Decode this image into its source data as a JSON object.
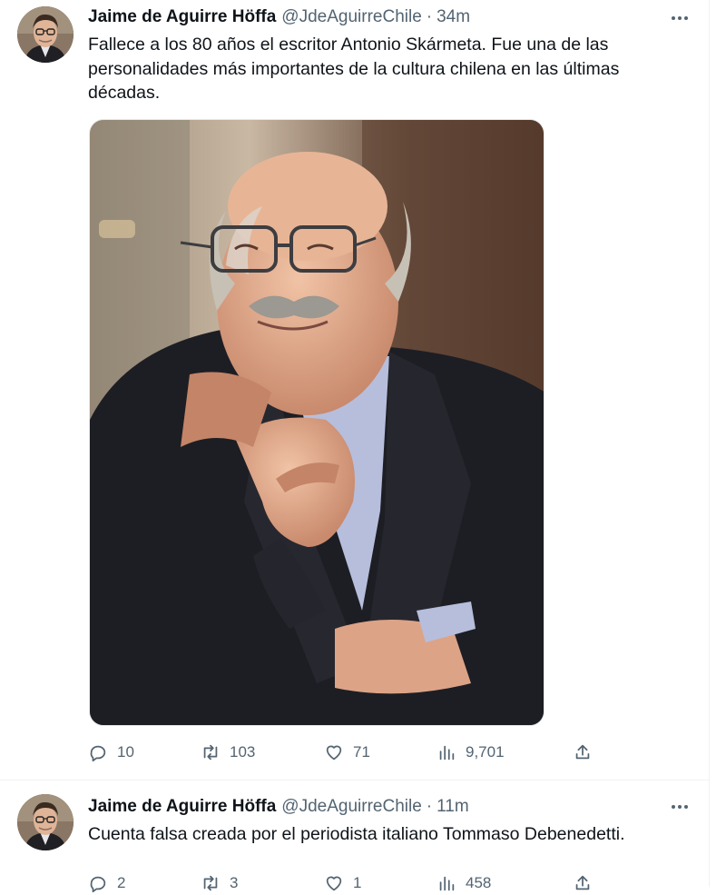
{
  "tweets": [
    {
      "author_name": "Jaime de Aguirre Höffa",
      "handle": "@JdeAguirreChile",
      "separator": "·",
      "time": "34m",
      "text": "Fallece a los 80 años el escritor Antonio Skármeta. Fue una de las personalidades más importantes de la cultura chilena en las últimas décadas.",
      "media": "photo",
      "stats": {
        "replies": "10",
        "retweets": "103",
        "likes": "71",
        "views": "9,701"
      }
    },
    {
      "author_name": "Jaime de Aguirre Höffa",
      "handle": "@JdeAguirreChile",
      "separator": "·",
      "time": "11m",
      "text": "Cuenta falsa creada por el periodista italiano Tommaso Debenedetti.",
      "stats": {
        "replies": "2",
        "retweets": "3",
        "likes": "1",
        "views": "458"
      }
    }
  ],
  "icons": {
    "more": "more-horizontal-icon",
    "reply": "reply-icon",
    "retweet": "retweet-icon",
    "like": "heart-icon",
    "views": "analytics-icon",
    "share": "share-icon"
  },
  "colors": {
    "text": "#0f1419",
    "secondary": "#536471",
    "border": "#eff3f4"
  }
}
